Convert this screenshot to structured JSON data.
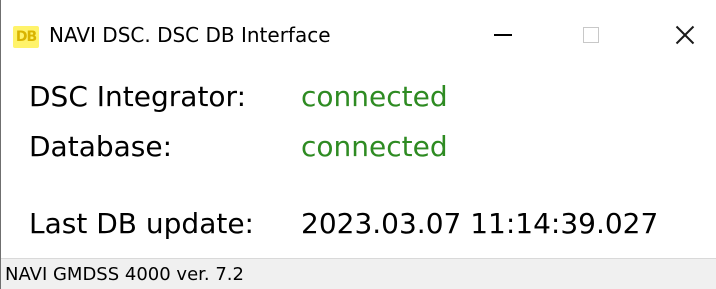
{
  "window": {
    "icon_text": "DB",
    "title": "NAVI DSC. DSC DB Interface",
    "icon_color": "#fff36a"
  },
  "status_rows": [
    {
      "label": "DSC Integrator:",
      "value": "connected",
      "value_color": "#2e8b22"
    },
    {
      "label": "Database:",
      "value": "connected",
      "value_color": "#2e8b22"
    }
  ],
  "last_update": {
    "label": "Last DB update:",
    "value": "2023.03.07 11:14:39.027"
  },
  "statusbar": {
    "text": "NAVI GMDSS 4000 ver. 7.2"
  }
}
